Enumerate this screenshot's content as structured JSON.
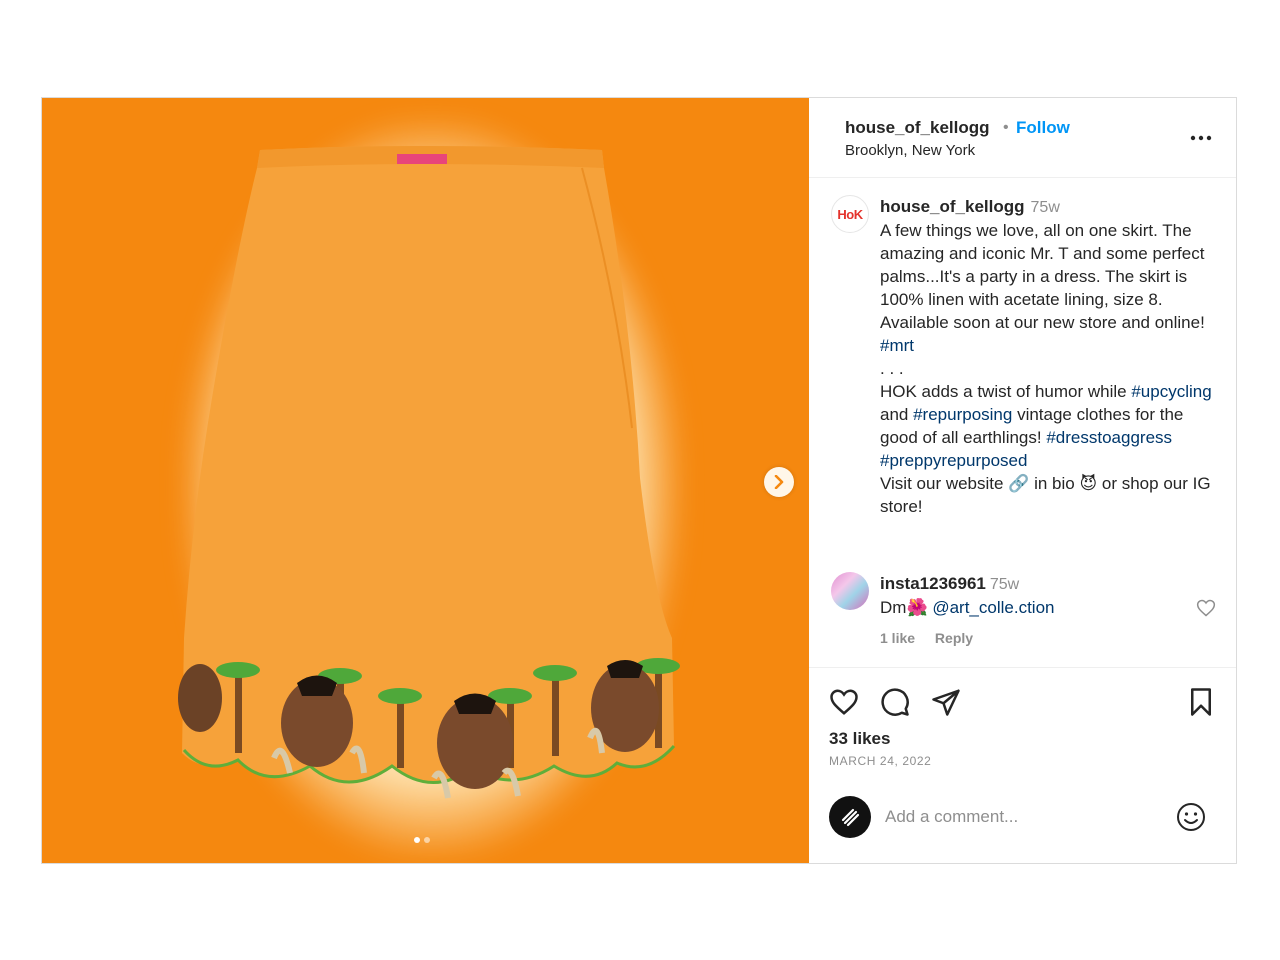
{
  "post": {
    "username": "house_of_kellogg",
    "separator": "•",
    "follow_label": "Follow",
    "location": "Brooklyn, New York",
    "more_icon": "more-horizontal-icon"
  },
  "caption": {
    "username": "house_of_kellogg",
    "time": "75w",
    "avatar_text": "HoK",
    "text1": "A few things we love, all on one skirt. The amazing and iconic Mr. T and some perfect palms...It's a party in a dress. The skirt is 100% linen with acetate lining, size 8. Available soon at our new store and online! ",
    "tag_mrt": "#mrt",
    "dots": ". . .",
    "text2": "HOK adds a twist of humor while ",
    "tag_upcycling": "#upcycling",
    "and": " and ",
    "tag_repurposing": "#repurposing",
    "text3": " vintage clothes for the good of all earthlings! ",
    "tag_dresstoaggress": "#dresstoaggress",
    "space": " ",
    "tag_preppy": "#preppyrepurposed",
    "text4": "Visit our website 🔗 in bio 😈 or shop our IG store!"
  },
  "comment": {
    "username": "insta1236961",
    "time": "75w",
    "text": "Dm🌺 ",
    "mention": "@art_colle.ction",
    "likes": "1 like",
    "reply": "Reply"
  },
  "actions": {
    "likes": "33 likes",
    "date": "MARCH 24, 2022",
    "add_comment_placeholder": "Add a comment..."
  },
  "colors": {
    "background_orange": "#f5880f",
    "skirt": "#f6a23a",
    "link_blue": "#0095f6",
    "hashtag_blue": "#00376b"
  },
  "carousel": {
    "current": 1,
    "total": 2
  }
}
